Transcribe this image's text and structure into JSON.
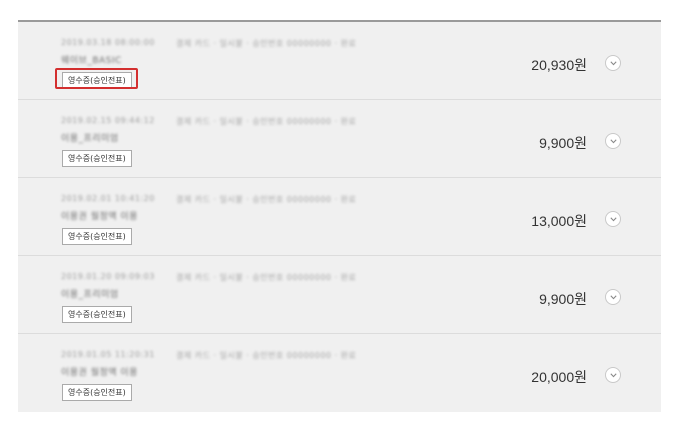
{
  "receipt_button_label": "영수증(승인전표)",
  "transactions": [
    {
      "date_blurred": "2019.03.18 08:00:00",
      "details_blurred": "결제 카드 · 일시불 · 승인번호 00000000 · 완료",
      "item_blurred": "웨이브_BASIC",
      "amount": "20,930원",
      "highlighted": true
    },
    {
      "date_blurred": "2019.02.15 09:44:12",
      "details_blurred": "결제 카드 · 일시불 · 승인번호 00000000 · 완료",
      "item_blurred": "이용_프리미엄",
      "amount": "9,900원",
      "highlighted": false
    },
    {
      "date_blurred": "2019.02.01 10:41:20",
      "details_blurred": "결제 카드 · 일시불 · 승인번호 00000000 · 완료",
      "item_blurred": "이용권 월정액 이용",
      "amount": "13,000원",
      "highlighted": false
    },
    {
      "date_blurred": "2019.01.20 09:09:03",
      "details_blurred": "결제 카드 · 일시불 · 승인번호 00000000 · 완료",
      "item_blurred": "이용_프리미엄",
      "amount": "9,900원",
      "highlighted": false
    },
    {
      "date_blurred": "2019.01.05 11:20:31",
      "details_blurred": "결제 카드 · 일시불 · 승인번호 00000000 · 완료",
      "item_blurred": "이용권 월정액 이용",
      "amount": "20,000원",
      "highlighted": false
    }
  ],
  "colors": {
    "panel_background": "#f0f0f0",
    "highlight_border": "#d32f2f"
  },
  "icons": {
    "expand": "chevron-down-icon"
  }
}
